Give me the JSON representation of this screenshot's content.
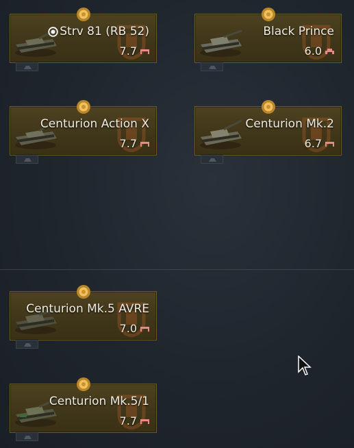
{
  "vehicles": [
    {
      "name": "Strv 81 (RB 52)",
      "br": "7.7",
      "premium_marker": true,
      "br_icon": "tank-class-icon"
    },
    {
      "name": "Black Prince",
      "br": "6.0",
      "premium_marker": false,
      "br_icon": "heavy-tank-class-icon"
    },
    {
      "name": "Centurion Action X",
      "br": "7.7",
      "premium_marker": false,
      "br_icon": "tank-class-icon"
    },
    {
      "name": "Centurion Mk.2",
      "br": "6.7",
      "premium_marker": false,
      "br_icon": "tank-class-icon"
    },
    {
      "name": "Centurion Mk.5 AVRE",
      "br": "7.0",
      "premium_marker": false,
      "br_icon": "tank-class-icon"
    },
    {
      "name": "Centurion Mk.5/1",
      "br": "7.7",
      "premium_marker": false,
      "br_icon": "tank-class-icon"
    }
  ],
  "colors": {
    "tile_border": "#6b5a2a",
    "tile_bg": "#4d4220",
    "br_icon": "#e88a8a",
    "background": "#1f252d"
  }
}
